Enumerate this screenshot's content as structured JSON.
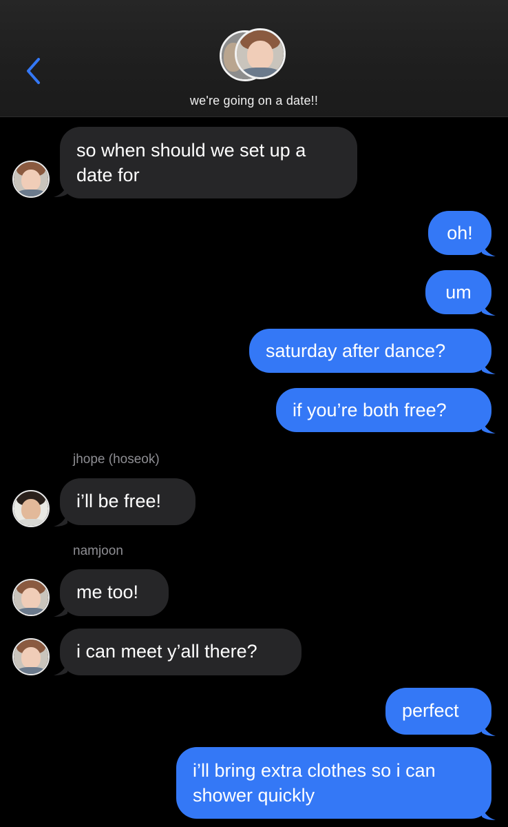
{
  "header": {
    "back_icon": "chevron-left-icon",
    "group_name": "we're going on a date!!"
  },
  "colors": {
    "accent": "#3478f6",
    "incoming_bubble": "#262628",
    "background": "#000000",
    "sender_label": "#8e8e93"
  },
  "messages": [
    {
      "direction": "in",
      "sender": "",
      "text_lines": [
        "so when should we set up a",
        "date for"
      ]
    },
    {
      "direction": "out",
      "text_lines": [
        "oh!"
      ]
    },
    {
      "direction": "out",
      "text_lines": [
        "um"
      ]
    },
    {
      "direction": "out",
      "text_lines": [
        "saturday after dance?"
      ]
    },
    {
      "direction": "out",
      "text_lines": [
        "if you’re both free?"
      ]
    },
    {
      "direction": "in",
      "sender": "jhope (hoseok)",
      "text_lines": [
        "i’ll be free!"
      ]
    },
    {
      "direction": "in",
      "sender": "namjoon",
      "text_lines": [
        "me too!"
      ]
    },
    {
      "direction": "in",
      "sender": "",
      "text_lines": [
        "i can meet y’all there?"
      ]
    },
    {
      "direction": "out",
      "text_lines": [
        "perfect"
      ]
    },
    {
      "direction": "out",
      "text_lines": [
        "i’ll bring extra clothes so i can",
        "shower quickly"
      ]
    }
  ]
}
